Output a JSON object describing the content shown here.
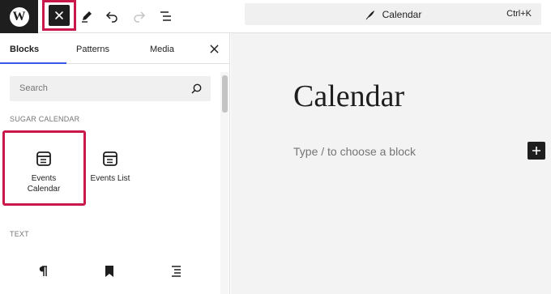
{
  "toolbar": {
    "logo_text": "W",
    "command": {
      "title": "Calendar",
      "shortcut": "Ctrl+K"
    }
  },
  "inserter": {
    "tabs": [
      {
        "label": "Blocks",
        "active": true
      },
      {
        "label": "Patterns",
        "active": false
      },
      {
        "label": "Media",
        "active": false
      }
    ],
    "search": {
      "placeholder": "Search"
    },
    "categories": [
      {
        "label": "SUGAR CALENDAR",
        "blocks": [
          {
            "label": "Events Calendar",
            "icon": "calendar-block-icon"
          },
          {
            "label": "Events List",
            "icon": "calendar-block-icon"
          }
        ]
      },
      {
        "label": "TEXT",
        "blocks": [
          {
            "label": "",
            "icon": "paragraph-icon"
          },
          {
            "label": "",
            "icon": "bookmark-icon"
          },
          {
            "label": "",
            "icon": "list-icon"
          }
        ]
      }
    ]
  },
  "editor": {
    "title": "Calendar",
    "placeholder": "Type / to choose a block"
  },
  "colors": {
    "highlight": "#c9184a",
    "accent": "#3858e9",
    "dark": "#1e1e1e",
    "canvas": "#f3f3f3"
  }
}
